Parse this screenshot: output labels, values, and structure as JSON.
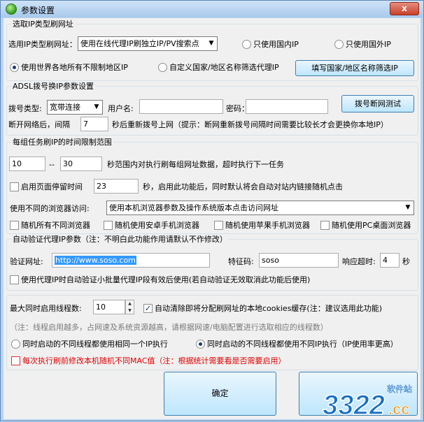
{
  "window": {
    "title": "参数设置",
    "close": "x"
  },
  "group1": {
    "legend": "选取IP类型刷网址",
    "type_label": "选用IP类型刷网址：",
    "type_select": "使用在线代理IP刷独立IP/PV搜索点",
    "radio_domestic": "只使用国内IP",
    "radio_foreign": "只使用国外IP",
    "radio_world": "使用世界各地所有不限制地区IP",
    "radio_custom": "自定义国家/地区名称筛选代理IP",
    "fill_button": "填写国家/地区名称筛选IP"
  },
  "group2": {
    "legend": "ADSL拨号换IP参数设置",
    "dial_type_label": "拨号类型:",
    "dial_type_value": "宽带连接",
    "username_label": "用户名:",
    "password_label": "密码：",
    "test_button": "拨号断网测试",
    "interval_prefix": "断开网络后，间隔",
    "interval_value": "7",
    "interval_suffix": "秒后重新拨号上网（提示：断网重新拨号间隔时间需要比较长才会更换你本地IP）"
  },
  "group3": {
    "legend": "每组任务刷IP的时间限制范围",
    "min_value": "10",
    "dash": "--",
    "max_value": "30",
    "range_text": "秒范围内对执行刷每组网址数据，超时执行下一任务",
    "dwell_label": "启用页面停留时间",
    "dwell_value": "23",
    "dwell_text": "秒，启用此功能后，同时默认将会自动对站内链接随机点击",
    "browser_label": "使用不同的浏览器访问:",
    "browser_select": "使用本机浏览器参数及操作系统版本点击访问网址",
    "cb_all": "随机所有不同浏览器",
    "cb_android": "随机使用安卓手机浏览器",
    "cb_apple": "随机使用苹果手机浏览器",
    "cb_pc": "随机使用PC桌面浏览器"
  },
  "group4": {
    "legend": "自动验证代理IP参数（注：不明白此功能作用请默认不作修改）",
    "url_label": "验证网址:",
    "url_value": "http://www.soso.com",
    "code_label": "特征码:",
    "code_value": "soso",
    "timeout_label": "响应超时:",
    "timeout_value": "4",
    "timeout_unit": "秒",
    "small_batch": "使用代理IP时自动验证小批量代理IP段有效后使用(若自动验证无效取消此功能后使用)"
  },
  "group5": {
    "threads_label": "最大同时启用线程数:",
    "threads_value": "10",
    "clear_cookies": "自动清除即将分配刷网址的本地cookies缓存(注：建议选用此功能)",
    "thread_hint": "（注：线程启用越多，占网速及系统资源越高，请根据网速/电脑配置进行选取相应的线程数）",
    "radio_same_ip": "同时启动的不同线程都使用相同一个IP执行",
    "radio_diff_ip": "同时启动的不同线程都使用不同IP执行（IP使用率更高）",
    "mac_change": "每次执行刷前修改本机随机不同MAC值（注：根据统计需要看是否需要启用）"
  },
  "buttons": {
    "ok": "确定"
  },
  "watermark": {
    "number": "3322",
    "suffix": ".cc",
    "site": "软件站"
  }
}
